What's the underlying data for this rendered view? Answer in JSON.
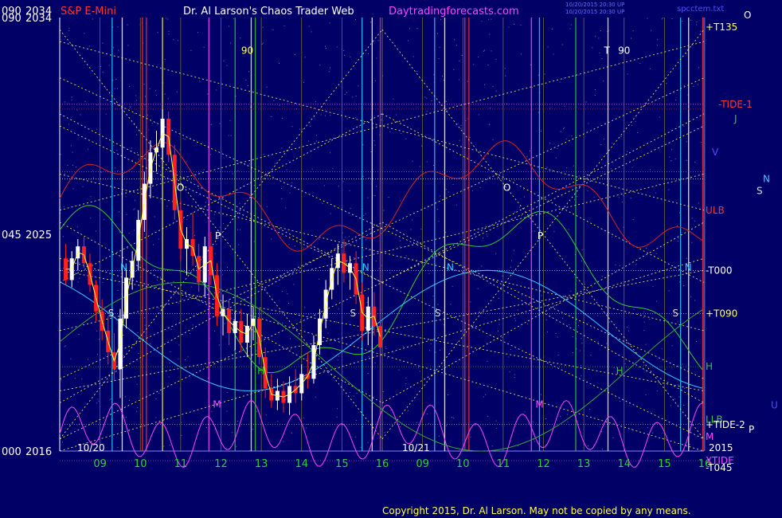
{
  "header": {
    "left_price_top": "090",
    "top_price": "2034",
    "instrument": "S&P E-Mini",
    "author_title": "Dr. Al Larson's Chaos Trader Web",
    "site": "Daytradingforecasts.com",
    "timestamp_line1": "10/20/2015 20:30 UP",
    "timestamp_line2": "10/20/2015 20:30 UP",
    "file_name": "spcctem.txt",
    "corner_letter": "O"
  },
  "chart_data": {
    "type": "candlestick",
    "title": "S&P E-Mini",
    "y_ticks": [
      {
        "angle": "090",
        "price": "2034"
      },
      {
        "angle": "045",
        "price": "2025"
      },
      {
        "angle": "000",
        "price": "2016"
      }
    ],
    "ylim": [
      2016,
      2034
    ],
    "x_ticks": [
      "09",
      "10",
      "11",
      "12",
      "13",
      "14",
      "15",
      "16",
      "09",
      "10",
      "11",
      "12",
      "13",
      "14",
      "15",
      "16"
    ],
    "date_labels": [
      "10/20",
      "10/21"
    ],
    "year_label": "2015",
    "right_labels": [
      {
        "text": "+T135",
        "price": 2033.6
      },
      {
        "text": "-TIDE-1",
        "price": 2030.4
      },
      {
        "text": "J",
        "price": 2029.8
      },
      {
        "text": "V",
        "price": 2028.4
      },
      {
        "text": "N",
        "price": 2027.3
      },
      {
        "text": "S",
        "price": 2026.8
      },
      {
        "text": "ULB",
        "price": 2026.0
      },
      {
        "text": "-T000",
        "price": 2023.5
      },
      {
        "text": "+T090",
        "price": 2021.7
      },
      {
        "text": "H",
        "price": 2019.5
      },
      {
        "text": "U",
        "price": 2017.9
      },
      {
        "text": "LLB",
        "price": 2017.3
      },
      {
        "text": "+TIDE-2",
        "price": 2017.1
      },
      {
        "text": "P",
        "price": 2016.9
      },
      {
        "text": "M",
        "price": 2016.6
      },
      {
        "text": "XTIDE",
        "price": 2015.6
      },
      {
        "text": "-T045",
        "price": 2015.3
      }
    ],
    "in_chart_labels": [
      {
        "text": "90",
        "pos": "day1"
      },
      {
        "text": "T",
        "pos": "day2"
      },
      {
        "text": "90",
        "pos": "day2"
      },
      {
        "text": "O",
        "pos": "day1"
      },
      {
        "text": "O",
        "pos": "day2"
      },
      {
        "text": "P",
        "pos": "day1"
      },
      {
        "text": "P",
        "pos": "day2"
      },
      {
        "text": "N",
        "pos": "day1"
      },
      {
        "text": "N",
        "pos": "day1"
      },
      {
        "text": "N",
        "pos": "day2"
      },
      {
        "text": "N",
        "pos": "day2"
      },
      {
        "text": "S",
        "pos": "day1"
      },
      {
        "text": "S",
        "pos": "day1"
      },
      {
        "text": "S",
        "pos": "day2"
      },
      {
        "text": "S",
        "pos": "day2"
      },
      {
        "text": "H",
        "pos": "day1"
      },
      {
        "text": "H",
        "pos": "day2"
      },
      {
        "text": "M",
        "pos": "day1"
      },
      {
        "text": "M",
        "pos": "day2"
      }
    ],
    "price_series": [
      {
        "t": 8.15,
        "o": 2024.0,
        "h": 2024.6,
        "l": 2022.9,
        "c": 2023.1
      },
      {
        "t": 8.3,
        "o": 2023.1,
        "h": 2024.3,
        "l": 2022.8,
        "c": 2024.0
      },
      {
        "t": 8.45,
        "o": 2024.0,
        "h": 2024.8,
        "l": 2023.5,
        "c": 2024.5
      },
      {
        "t": 8.6,
        "o": 2024.5,
        "h": 2024.9,
        "l": 2023.6,
        "c": 2023.8
      },
      {
        "t": 8.75,
        "o": 2023.8,
        "h": 2024.2,
        "l": 2022.6,
        "c": 2022.9
      },
      {
        "t": 8.9,
        "o": 2022.9,
        "h": 2023.1,
        "l": 2021.4,
        "c": 2021.8
      },
      {
        "t": 9.05,
        "o": 2021.8,
        "h": 2022.3,
        "l": 2020.6,
        "c": 2021.0
      },
      {
        "t": 9.2,
        "o": 2021.0,
        "h": 2021.6,
        "l": 2019.6,
        "c": 2020.1
      },
      {
        "t": 9.35,
        "o": 2020.1,
        "h": 2020.9,
        "l": 2018.9,
        "c": 2019.4
      },
      {
        "t": 9.5,
        "o": 2019.4,
        "h": 2021.9,
        "l": 2018.2,
        "c": 2021.5
      },
      {
        "t": 9.65,
        "o": 2021.5,
        "h": 2023.6,
        "l": 2021.1,
        "c": 2023.2
      },
      {
        "t": 9.8,
        "o": 2023.2,
        "h": 2024.3,
        "l": 2022.7,
        "c": 2023.9
      },
      {
        "t": 9.95,
        "o": 2023.9,
        "h": 2026.0,
        "l": 2023.5,
        "c": 2025.6
      },
      {
        "t": 10.1,
        "o": 2025.6,
        "h": 2027.6,
        "l": 2025.1,
        "c": 2027.1
      },
      {
        "t": 10.25,
        "o": 2027.1,
        "h": 2028.9,
        "l": 2026.5,
        "c": 2028.4
      },
      {
        "t": 10.4,
        "o": 2028.4,
        "h": 2029.3,
        "l": 2027.6,
        "c": 2028.6
      },
      {
        "t": 10.55,
        "o": 2028.6,
        "h": 2030.2,
        "l": 2028.1,
        "c": 2029.8
      },
      {
        "t": 10.7,
        "o": 2029.8,
        "h": 2030.1,
        "l": 2028.0,
        "c": 2028.3
      },
      {
        "t": 10.85,
        "o": 2028.3,
        "h": 2028.7,
        "l": 2025.6,
        "c": 2026.0
      },
      {
        "t": 11.0,
        "o": 2026.0,
        "h": 2026.4,
        "l": 2023.9,
        "c": 2024.4
      },
      {
        "t": 11.15,
        "o": 2024.4,
        "h": 2025.3,
        "l": 2023.3,
        "c": 2024.8
      },
      {
        "t": 11.3,
        "o": 2024.8,
        "h": 2025.9,
        "l": 2023.7,
        "c": 2024.1
      },
      {
        "t": 11.45,
        "o": 2024.1,
        "h": 2024.6,
        "l": 2022.6,
        "c": 2023.0
      },
      {
        "t": 11.6,
        "o": 2023.0,
        "h": 2024.9,
        "l": 2022.4,
        "c": 2024.5
      },
      {
        "t": 11.75,
        "o": 2024.5,
        "h": 2025.1,
        "l": 2022.9,
        "c": 2023.3
      },
      {
        "t": 11.9,
        "o": 2023.3,
        "h": 2023.8,
        "l": 2021.2,
        "c": 2021.6
      },
      {
        "t": 12.05,
        "o": 2021.6,
        "h": 2022.5,
        "l": 2020.8,
        "c": 2021.9
      },
      {
        "t": 12.2,
        "o": 2021.9,
        "h": 2022.3,
        "l": 2020.4,
        "c": 2020.9
      },
      {
        "t": 12.35,
        "o": 2020.9,
        "h": 2021.8,
        "l": 2020.2,
        "c": 2021.4
      },
      {
        "t": 12.5,
        "o": 2021.4,
        "h": 2021.9,
        "l": 2020.1,
        "c": 2020.5
      },
      {
        "t": 12.65,
        "o": 2020.5,
        "h": 2021.7,
        "l": 2019.9,
        "c": 2021.2
      },
      {
        "t": 12.8,
        "o": 2021.2,
        "h": 2022.0,
        "l": 2020.6,
        "c": 2021.5
      },
      {
        "t": 12.95,
        "o": 2021.5,
        "h": 2021.9,
        "l": 2019.6,
        "c": 2019.9
      },
      {
        "t": 13.1,
        "o": 2019.9,
        "h": 2020.3,
        "l": 2018.2,
        "c": 2018.6
      },
      {
        "t": 13.25,
        "o": 2018.6,
        "h": 2019.2,
        "l": 2017.8,
        "c": 2018.1
      },
      {
        "t": 13.4,
        "o": 2018.1,
        "h": 2019.0,
        "l": 2017.7,
        "c": 2018.5
      },
      {
        "t": 13.55,
        "o": 2018.5,
        "h": 2018.9,
        "l": 2017.6,
        "c": 2018.0
      },
      {
        "t": 13.7,
        "o": 2018.0,
        "h": 2019.1,
        "l": 2017.5,
        "c": 2018.7
      },
      {
        "t": 13.85,
        "o": 2018.7,
        "h": 2019.4,
        "l": 2018.0,
        "c": 2018.4
      },
      {
        "t": 14.0,
        "o": 2018.4,
        "h": 2019.6,
        "l": 2018.1,
        "c": 2019.2
      },
      {
        "t": 14.15,
        "o": 2019.2,
        "h": 2020.1,
        "l": 2018.6,
        "c": 2019.0
      },
      {
        "t": 14.3,
        "o": 2019.0,
        "h": 2020.8,
        "l": 2018.8,
        "c": 2020.4
      },
      {
        "t": 14.45,
        "o": 2020.4,
        "h": 2021.9,
        "l": 2020.0,
        "c": 2021.5
      },
      {
        "t": 14.6,
        "o": 2021.5,
        "h": 2023.1,
        "l": 2021.1,
        "c": 2022.7
      },
      {
        "t": 14.75,
        "o": 2022.7,
        "h": 2024.0,
        "l": 2022.3,
        "c": 2023.6
      },
      {
        "t": 14.9,
        "o": 2023.6,
        "h": 2024.6,
        "l": 2022.9,
        "c": 2024.2
      },
      {
        "t": 15.05,
        "o": 2024.2,
        "h": 2024.8,
        "l": 2023.0,
        "c": 2023.4
      },
      {
        "t": 15.2,
        "o": 2023.4,
        "h": 2024.1,
        "l": 2022.7,
        "c": 2023.8
      },
      {
        "t": 15.35,
        "o": 2023.8,
        "h": 2024.3,
        "l": 2022.1,
        "c": 2022.5
      },
      {
        "t": 15.5,
        "o": 2022.5,
        "h": 2023.0,
        "l": 2020.6,
        "c": 2021.0
      },
      {
        "t": 15.65,
        "o": 2021.0,
        "h": 2022.4,
        "l": 2020.4,
        "c": 2022.0
      },
      {
        "t": 15.8,
        "o": 2022.0,
        "h": 2022.6,
        "l": 2020.8,
        "c": 2021.2
      },
      {
        "t": 15.95,
        "o": 2021.2,
        "h": 2021.5,
        "l": 2019.9,
        "c": 2020.3
      }
    ]
  },
  "footer": {
    "copyright": "Copyright 2015, Dr. Al Larson. May not be copied by any means."
  },
  "colors": {
    "background": "#000066",
    "grid": "#6f6f34",
    "up_candle": "#ffffff",
    "down_candle": "#ff2020",
    "axis_text": "#ffffff",
    "x_tick_text": "#2bd32b",
    "title_red": "#ff3333",
    "site_magenta": "#ff44ff",
    "right_yellow": "#ffff66",
    "cycle_red": "#dd2020",
    "cycle_green": "#33cc33",
    "cycle_cyan": "#33ccff",
    "cycle_magenta": "#ff44ff",
    "cycle_yellow": "#ffff44"
  }
}
